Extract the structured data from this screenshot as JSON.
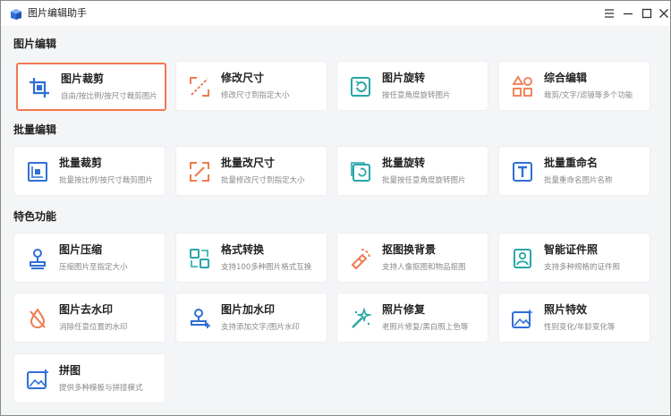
{
  "window": {
    "title": "图片编辑助手"
  },
  "colors": {
    "accent": "#f07a4f",
    "blue": "#2f6fd6",
    "teal": "#29a6a6",
    "orange": "#f07a4f"
  },
  "sections": [
    {
      "title": "图片编辑",
      "cards": [
        {
          "title": "图片裁剪",
          "subtitle": "自由/按比例/按尺寸裁剪图片",
          "icon": "crop-icon",
          "selected": true
        },
        {
          "title": "修改尺寸",
          "subtitle": "修改尺寸到指定大小",
          "icon": "resize-icon"
        },
        {
          "title": "图片旋转",
          "subtitle": "按任意角度旋转图片",
          "icon": "rotate-icon"
        },
        {
          "title": "综合编辑",
          "subtitle": "裁剪/文字/滤镜等多个功能",
          "icon": "shapes-icon"
        }
      ]
    },
    {
      "title": "批量编辑",
      "cards": [
        {
          "title": "批量裁剪",
          "subtitle": "批量按比例/按尺寸裁剪图片",
          "icon": "batch-crop-icon"
        },
        {
          "title": "批量改尺寸",
          "subtitle": "批量修改尺寸到指定大小",
          "icon": "batch-resize-icon"
        },
        {
          "title": "批量旋转",
          "subtitle": "批量按任意角度旋转图片",
          "icon": "batch-rotate-icon"
        },
        {
          "title": "批量重命名",
          "subtitle": "批量重命名图片名称",
          "icon": "text-rename-icon"
        }
      ]
    },
    {
      "title": "特色功能",
      "cards": [
        {
          "title": "图片压缩",
          "subtitle": "压缩图片至指定大小",
          "icon": "compress-stamp-icon"
        },
        {
          "title": "格式转换",
          "subtitle": "支持100多种图片格式互换",
          "icon": "format-convert-icon"
        },
        {
          "title": "抠图换背景",
          "subtitle": "支持人像抠图和物品抠图",
          "icon": "cutout-icon"
        },
        {
          "title": "智能证件照",
          "subtitle": "支持多种规格的证件照",
          "icon": "id-photo-icon"
        },
        {
          "title": "图片去水印",
          "subtitle": "消除任意位置的水印",
          "icon": "remove-watermark-icon"
        },
        {
          "title": "图片加水印",
          "subtitle": "支持添加文字/图片水印",
          "icon": "add-watermark-icon"
        },
        {
          "title": "照片修复",
          "subtitle": "老照片修复/黑白照上色等",
          "icon": "magic-wand-icon"
        },
        {
          "title": "照片特效",
          "subtitle": "性别变化/年龄变化等",
          "icon": "photo-effects-icon"
        },
        {
          "title": "拼图",
          "subtitle": "提供多种模板与拼接模式",
          "icon": "collage-icon"
        }
      ]
    }
  ]
}
